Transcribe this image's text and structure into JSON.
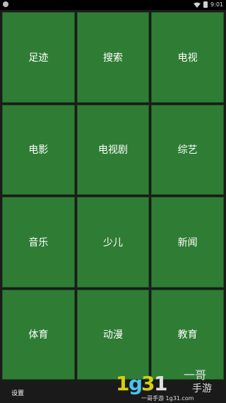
{
  "status_bar": {
    "time": "9:01",
    "icons": [
      "notification-dot-icon",
      "wifi-icon",
      "battery-icon"
    ]
  },
  "tiles": [
    {
      "label": "足迹"
    },
    {
      "label": "搜索"
    },
    {
      "label": "电视"
    },
    {
      "label": "电影"
    },
    {
      "label": "电视剧"
    },
    {
      "label": "综艺"
    },
    {
      "label": "音乐"
    },
    {
      "label": "少儿"
    },
    {
      "label": "新闻"
    },
    {
      "label": "体育"
    },
    {
      "label": "动漫"
    },
    {
      "label": "教育"
    }
  ],
  "bottom": {
    "settings_label": "设置"
  },
  "watermark": {
    "brand": "1g31",
    "text_top": "一哥",
    "text_right": "手游",
    "text_bottom": "一哥手游 1g31.com"
  },
  "colors": {
    "tile_green": "#2f7d34",
    "background": "#1b1b1b",
    "status_bar": "#000000"
  }
}
